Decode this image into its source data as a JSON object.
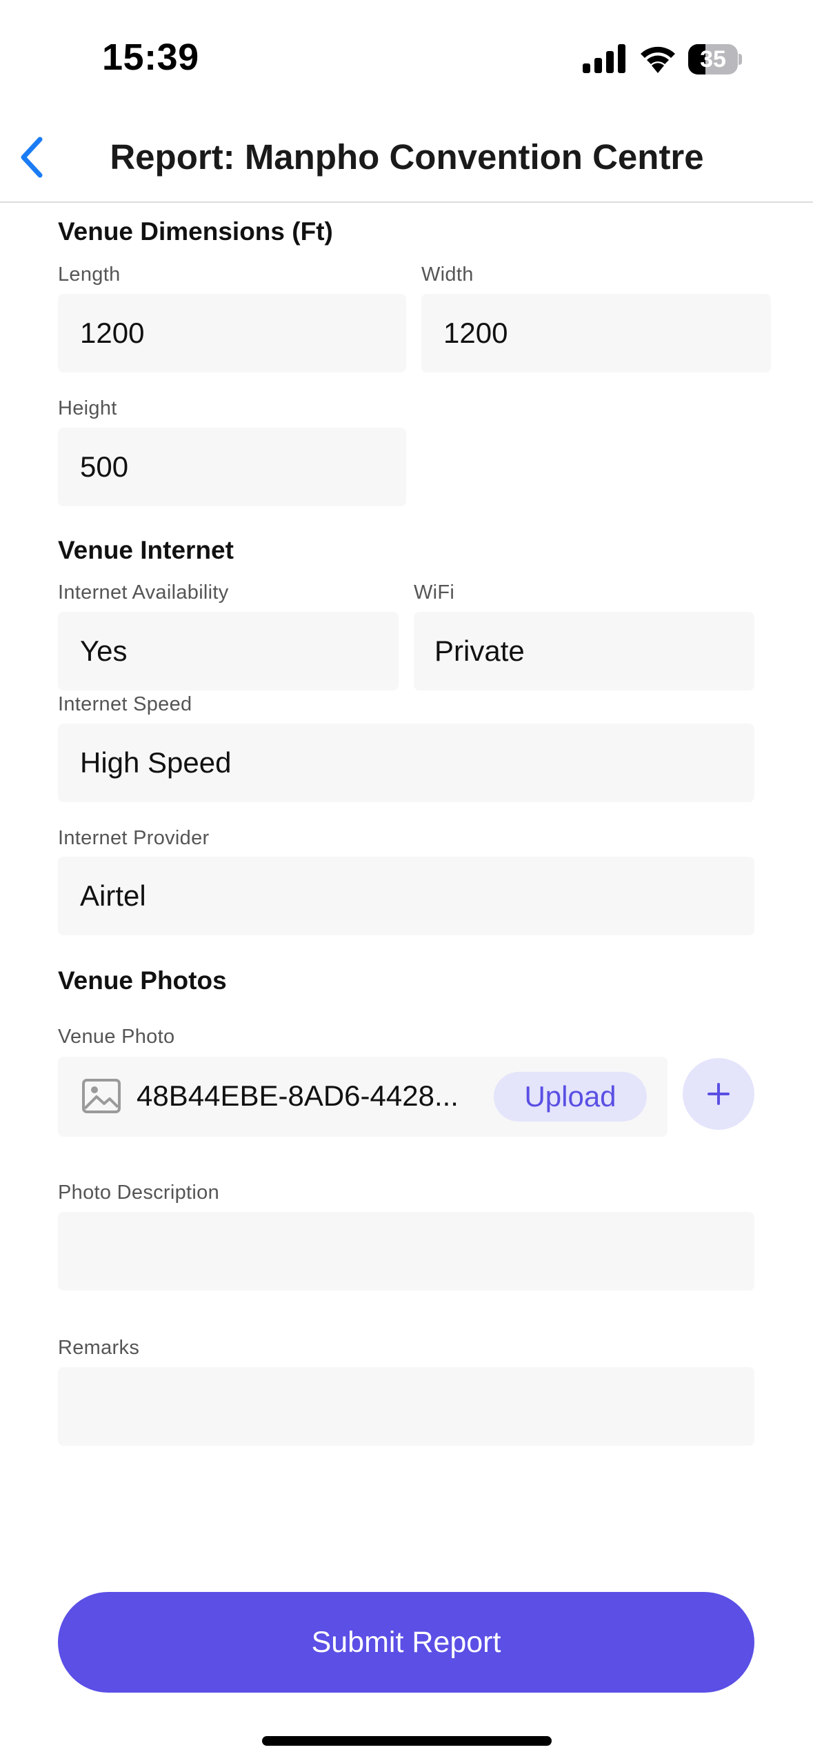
{
  "status_bar": {
    "time": "15:39",
    "battery_level": "35",
    "battery_fraction": 0.35,
    "icons": [
      "cellular-signal-icon",
      "wifi-icon",
      "battery-icon"
    ]
  },
  "nav": {
    "back_icon": "chevron-left-icon",
    "title": "Report: Manpho Convention Centre"
  },
  "dimensions": {
    "section_title": "Venue Dimensions (Ft)",
    "length_label": "Length",
    "length_value": "1200",
    "width_label": "Width",
    "width_value": "1200",
    "height_label": "Height",
    "height_value": "500"
  },
  "internet": {
    "section_title": "Venue Internet",
    "availability_label": "Internet Availability",
    "availability_value": "Yes",
    "wifi_label": "WiFi",
    "wifi_value": "Private",
    "speed_label": "Internet Speed",
    "speed_value": "High Speed",
    "provider_label": "Internet Provider",
    "provider_value": "Airtel"
  },
  "photos": {
    "section_title": "Venue Photos",
    "photo_label": "Venue Photo",
    "photo_icon": "image-icon",
    "photo_filename": "48B44EBE-8AD6-4428...",
    "upload_label": "Upload",
    "add_icon": "plus-icon",
    "description_label": "Photo Description",
    "description_value": "",
    "remarks_label": "Remarks",
    "remarks_value": ""
  },
  "submit_label": "Submit Report",
  "colors": {
    "accent": "#5b4fe6",
    "accent_light": "#e4e4fb",
    "back_chevron": "#1a7cf5",
    "field_background": "#f7f7f7"
  }
}
